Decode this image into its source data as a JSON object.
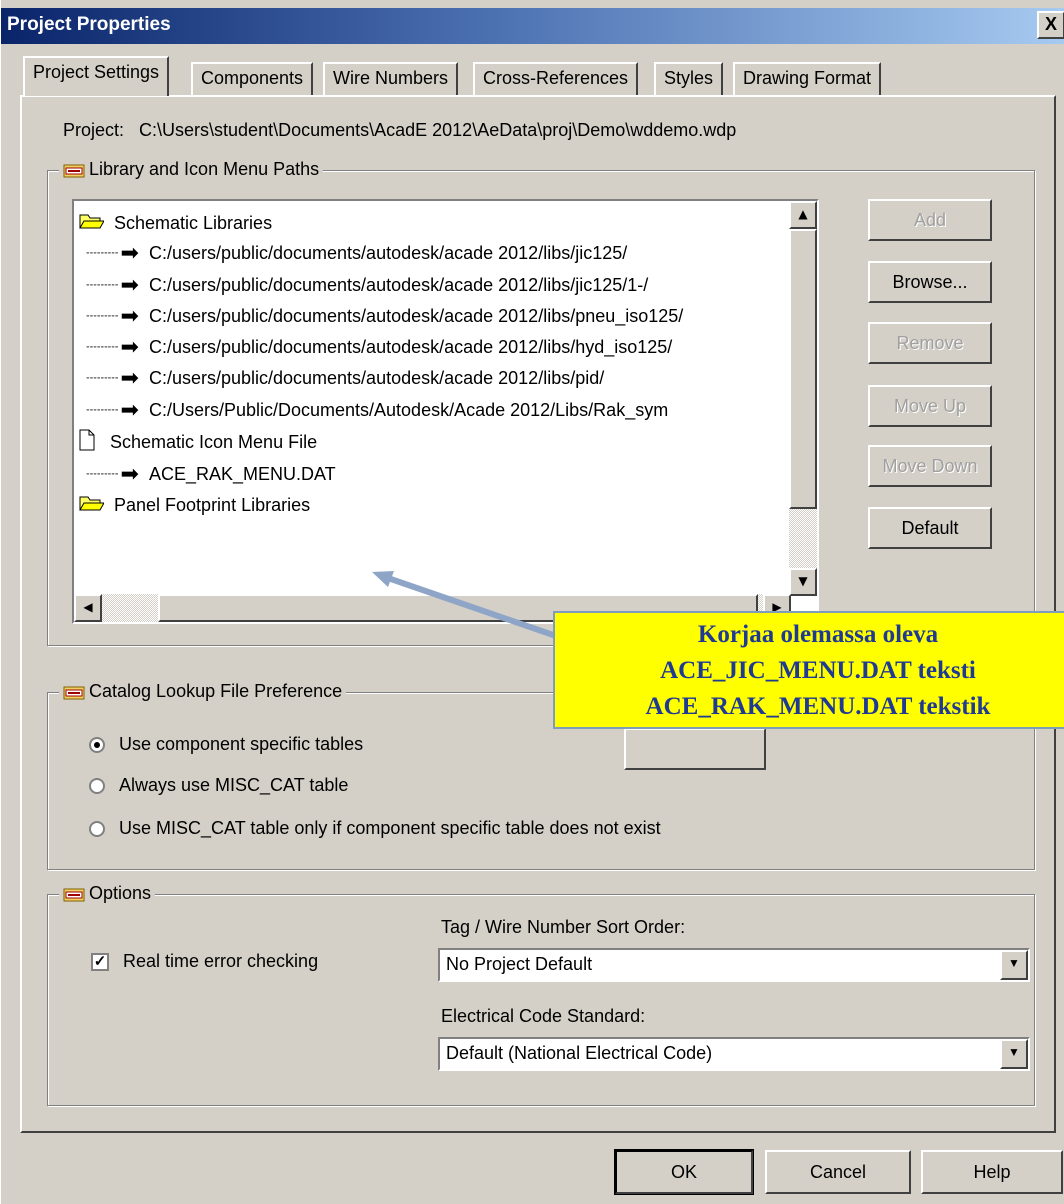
{
  "window": {
    "title": "Project Properties",
    "close_label": "X"
  },
  "tabs": [
    {
      "label": "Project Settings"
    },
    {
      "label": "Components"
    },
    {
      "label": "Wire Numbers"
    },
    {
      "label": "Cross-References"
    },
    {
      "label": "Styles"
    },
    {
      "label": "Drawing Format"
    }
  ],
  "project_line": "Project:   C:\\Users\\student\\Documents\\AcadE 2012\\AeData\\proj\\Demo\\wddemo.wdp",
  "library_group": {
    "label": "Library and Icon Menu Paths",
    "tree": [
      {
        "text": "Schematic Libraries"
      },
      {
        "text": "C:/users/public/documents/autodesk/acade 2012/libs/jic125/"
      },
      {
        "text": "C:/users/public/documents/autodesk/acade 2012/libs/jic125/1-/"
      },
      {
        "text": "C:/users/public/documents/autodesk/acade 2012/libs/pneu_iso125/"
      },
      {
        "text": "C:/users/public/documents/autodesk/acade 2012/libs/hyd_iso125/"
      },
      {
        "text": "C:/users/public/documents/autodesk/acade 2012/libs/pid/"
      },
      {
        "text": "C:/Users/Public/Documents/Autodesk/Acade 2012/Libs/Rak_sym"
      },
      {
        "text": "Schematic Icon Menu File"
      },
      {
        "text": "ACE_RAK_MENU.DAT"
      },
      {
        "text": "Panel Footprint Libraries"
      }
    ],
    "buttons": {
      "add": "Add",
      "browse": "Browse...",
      "remove": "Remove",
      "move_up": "Move Up",
      "move_down": "Move Down",
      "default": "Default"
    }
  },
  "catalog_group": {
    "label": "Catalog Lookup File Preference",
    "options": [
      {
        "label": "Use component specific tables",
        "selected": true
      },
      {
        "label": "Always use MISC_CAT table",
        "selected": false
      },
      {
        "label": "Use MISC_CAT table only if component specific table does not exist",
        "selected": false
      }
    ]
  },
  "options_group": {
    "label": "Options",
    "realtime_check": {
      "label": "Real time error checking",
      "checked": true
    },
    "sort_order": {
      "label": "Tag / Wire Number Sort Order:",
      "value": "No Project Default"
    },
    "code_standard": {
      "label": "Electrical Code Standard:",
      "value": "Default (National Electrical Code)"
    }
  },
  "footer": {
    "ok": "OK",
    "cancel": "Cancel",
    "help": "Help"
  },
  "callout": {
    "line1": "Korjaa olemassa oleva",
    "line2": "ACE_JIC_MENU.DAT teksti",
    "line3": "ACE_RAK_MENU.DAT tekstik"
  },
  "colors": {
    "titlebar": "#0a246a",
    "callout_bg": "#ffff00",
    "callout_text": "#1f3a93",
    "dialog_bg": "#d4d0c8"
  }
}
